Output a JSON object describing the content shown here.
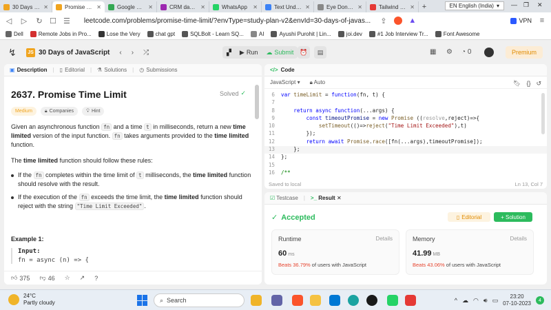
{
  "browser": {
    "tabs": [
      {
        "title": "30 Days of Java",
        "color": "#f0a41f",
        "active": false
      },
      {
        "title": "Promise Tim",
        "color": "#f0a41f",
        "active": true
      },
      {
        "title": "Google Meet",
        "color": "#34a853",
        "active": false
      },
      {
        "title": "CRM dashboar",
        "color": "#9c27b0",
        "active": false
      },
      {
        "title": "WhatsApp",
        "color": "#25d366",
        "active": false
      },
      {
        "title": "Text Underline",
        "color": "#3b82f6",
        "active": false
      },
      {
        "title": "Eye Donation A",
        "color": "#888888",
        "active": false
      },
      {
        "title": "Tailwind CSS Ful",
        "color": "#e53935",
        "active": false
      }
    ],
    "language": "EN English (India)",
    "url": "leetcode.com/problems/promise-time-limit/?envType=study-plan-v2&envId=30-days-of-javas...",
    "vpn_label": "VPN",
    "bookmarks": [
      {
        "label": "Dell",
        "color": "#666666"
      },
      {
        "label": "Remote Jobs in Pro...",
        "color": "#d32f2f"
      },
      {
        "label": "Lose the Very",
        "color": "#333333"
      },
      {
        "label": "chat gpt",
        "color": "#555555"
      },
      {
        "label": "SQLBolt - Learn SQ...",
        "color": "#555555"
      },
      {
        "label": "AI",
        "color": "#888888"
      },
      {
        "label": "Ayushi Purohit | Lin...",
        "color": "#555555"
      },
      {
        "label": "joi.dev",
        "color": "#555555"
      },
      {
        "label": "#1 Job Interview Tr...",
        "color": "#555555"
      },
      {
        "label": "Font Awesome",
        "color": "#555555"
      }
    ]
  },
  "header": {
    "badge": "JS",
    "title": "30 Days of JavaScript",
    "run_label": "Run",
    "submit_label": "Submit",
    "streak": "0",
    "premium_label": "Premium"
  },
  "left_tabs": [
    {
      "label": "Description",
      "active": true,
      "icon": "description-icon"
    },
    {
      "label": "Editorial",
      "active": false,
      "icon": "editorial-icon"
    },
    {
      "label": "Solutions",
      "active": false,
      "icon": "solutions-icon"
    },
    {
      "label": "Submissions",
      "active": false,
      "icon": "submissions-icon"
    }
  ],
  "problem": {
    "title": "2637. Promise Time Limit",
    "status": "Solved",
    "difficulty": "Medium",
    "companies": "Companies",
    "hint": "Hint",
    "p1a": "Given an asynchronous function ",
    "p1b": "fn",
    "p1c": " and a time ",
    "p1d": "t",
    "p1e": " in milliseconds, return a new ",
    "p1f": "time limited",
    "p1g": " version of the input function. ",
    "p1h": "fn",
    "p1i": " takes arguments provided to the ",
    "p1j": "time limited",
    "p1k": " function.",
    "p2a": "The ",
    "p2b": "time limited",
    "p2c": " function should follow these rules:",
    "b1a": "If the ",
    "b1b": "fn",
    "b1c": " completes within the time limit of ",
    "b1d": "t",
    "b1e": " milliseconds, the ",
    "b1f": "time limited",
    "b1g": " function should resolve with the result.",
    "b2a": "If the execution of the ",
    "b2b": "fn",
    "b2c": " exceeds the time limit, the ",
    "b2d": "time limited",
    "b2e": " function should reject with the string ",
    "b2f": "\"Time Limit Exceeded\"",
    "b2g": ".",
    "example_title": "Example 1:",
    "example_input": "Input:",
    "example_line": "fn = async (n) => {",
    "likes": "375",
    "dislikes": "46"
  },
  "code": {
    "title": "Code",
    "language": "JavaScript",
    "mode": "Auto",
    "saved": "Saved to local",
    "position": "Ln 13, Col 7",
    "lines": [
      {
        "n": "6"
      },
      {
        "n": "7"
      },
      {
        "n": "8"
      },
      {
        "n": "9"
      },
      {
        "n": "10"
      },
      {
        "n": "11"
      },
      {
        "n": "12"
      },
      {
        "n": "13"
      },
      {
        "n": "14"
      },
      {
        "n": "15"
      },
      {
        "n": "16"
      }
    ],
    "tokens": {
      "l6a": "var ",
      "l6b": "timeLimit",
      "l6c": " = ",
      "l6d": "function",
      "l6e": "(fn, t) {",
      "l8a": "    return ",
      "l8b": "async ",
      "l8c": "function",
      "l8d": "(...args) {",
      "l9a": "        const ",
      "l9b": "timeoutPromise",
      "l9c": " = ",
      "l9d": "new ",
      "l9e": "Promise",
      "l9f": " ((",
      "l9g": "resolve",
      "l9h": ",reject)=>{",
      "l10a": "            ",
      "l10b": "setTimeout",
      "l10c": "(()=>",
      "l10d": "reject",
      "l10e": "(",
      "l10f": "\"Time Limit Exceeded\"",
      "l10g": "),t)",
      "l11a": "        });",
      "l12a": "        return ",
      "l12b": "await ",
      "l12c": "Promise",
      "l12d": ".",
      "l12e": "race",
      "l12f": "([fn(...args),timeoutPromise]);",
      "l13a": "    };",
      "l14a": "};",
      "l16a": "/**"
    }
  },
  "result": {
    "testcase_label": "Testcase",
    "result_label": "Result",
    "status": "Accepted",
    "editorial_label": "Editorial",
    "solution_label": "+ Solution",
    "runtime": {
      "label": "Runtime",
      "details": "Details",
      "value": "60",
      "unit": "ms",
      "beats_pct": "Beats 36.79%",
      "beats_rest": " of users with JavaScript"
    },
    "memory": {
      "label": "Memory",
      "details": "Details",
      "value": "41.99",
      "unit": "MB",
      "beats_pct": "Beats 43.06%",
      "beats_rest": " of users with JavaScript"
    }
  },
  "taskbar": {
    "temp": "24°C",
    "weather": "Partly cloudy",
    "search": "Search",
    "time": "23:20",
    "date": "07-10-2023",
    "notifications": "4",
    "apps": [
      {
        "name": "files-app-icon",
        "color": "#f0b429"
      },
      {
        "name": "teams-app-icon",
        "color": "#6264a7"
      },
      {
        "name": "brave-app-icon",
        "color": "#fb542b"
      },
      {
        "name": "explorer-app-icon",
        "color": "#f5c242"
      },
      {
        "name": "vscode-app-icon",
        "color": "#0078d4"
      },
      {
        "name": "edge-app-icon",
        "color": "#1ba3a1"
      },
      {
        "name": "dell-app-icon",
        "color": "#1a1a1a"
      },
      {
        "name": "whatsapp-app-icon",
        "color": "#25d366"
      },
      {
        "name": "store-app-icon",
        "color": "#0063b1"
      },
      {
        "name": "snip-app-icon",
        "color": "#e53935"
      }
    ]
  }
}
